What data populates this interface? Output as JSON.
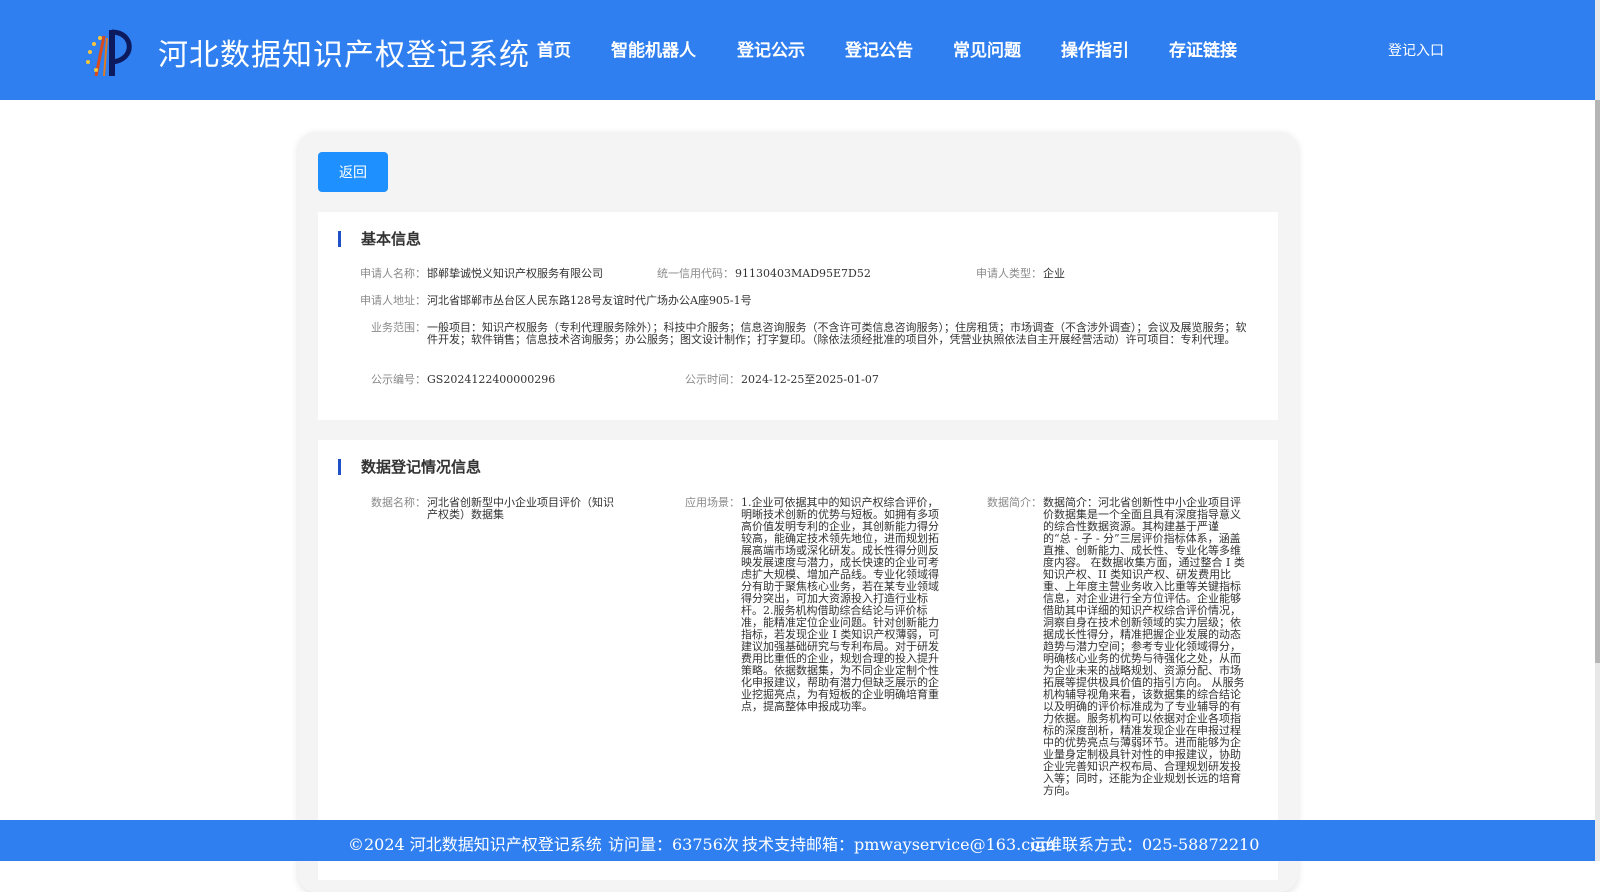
{
  "header": {
    "title": "河北数据知识产权登记系统",
    "nav": [
      "首页",
      "智能机器人",
      "登记公示",
      "登记公告",
      "常见问题",
      "操作指引",
      "存证链接"
    ],
    "login": "登记入口"
  },
  "toolbar": {
    "back_label": "返回"
  },
  "basic_info": {
    "title": "基本信息",
    "applicant_name_label": "申请人名称：",
    "applicant_name": "邯郸挚诚悦义知识产权服务有限公司",
    "credit_code_label": "统一信用代码：",
    "credit_code": "91130403MAD95E7D52",
    "applicant_type_label": "申请人类型：",
    "applicant_type": "企业",
    "address_label": "申请人地址：",
    "address": "河北省邯郸市丛台区人民东路128号友谊时代广场办公A座905-1号",
    "scope_label": "业务范围：",
    "scope": "一般项目：知识产权服务（专利代理服务除外）；科技中介服务；信息咨询服务（不含许可类信息咨询服务）；住房租赁；市场调查（不含涉外调查）；会议及展览服务；软件开发；软件销售；信息技术咨询服务；办公服务；图文设计制作；打字复印。（除依法须经批准的项目外，凭营业执照依法自主开展经营活动）许可项目：专利代理。",
    "pub_no_label": "公示编号：",
    "pub_no": "GS2024122400000296",
    "pub_time_label": "公示时间：",
    "pub_time": "2024-12-25至2025-01-07"
  },
  "data_info": {
    "title": "数据登记情况信息",
    "data_name_label": "数据名称：",
    "data_name": "河北省创新型中小企业项目评价（知识产权类）数据集",
    "scenario_label": "应用场景：",
    "scenario": "1.企业可依据其中的知识产权综合评价，明晰技术创新的优势与短板。如拥有多项高价值发明专利的企业，其创新能力得分较高，能确定技术领先地位，进而规划拓展高端市场或深化研发。成长性得分则反映发展速度与潜力，成长快速的企业可考虑扩大规模、增加产品线。专业化领域得分有助于聚焦核心业务，若在某专业领域得分突出，可加大资源投入打造行业标杆。2.服务机构借助综合结论与评价标准，能精准定位企业问题。针对创新能力指标，若发现企业 I 类知识产权薄弱，可建议加强基础研究与专利布局。对于研发费用比重低的企业，规划合理的投入提升策略。依据数据集，为不同企业定制个性化申报建议，帮助有潜力但缺乏展示的企业挖掘亮点，为有短板的企业明确培育重点，提高整体申报成功率。",
    "summary_label": "数据简介：",
    "summary": "数据简介：河北省创新性中小企业项目评价数据集是一个全面且具有深度指导意义的综合性数据资源。其构建基于严谨的“总 - 子 - 分”三层评价指标体系，涵盖直推、创新能力、成长性、专业化等多维度内容。 在数据收集方面，通过整合 I 类知识产权、II 类知识产权、研发费用比重、上年度主营业务收入比重等关键指标信息，对企业进行全方位评估。企业能够借助其中详细的知识产权综合评价情况，洞察自身在技术创新领域的实力层级；依据成长性得分，精准把握企业发展的动态趋势与潜力空间；参考专业化领域得分，明确核心业务的优势与待强化之处，从而为企业未来的战略规划、资源分配、市场拓展等提供极具价值的指引方向。 从服务机构辅导视角来看，该数据集的综合结论以及明确的评价标准成为了专业辅导的有力依据。服务机构可以依据对企业各项指标的深度剖析，精准发现企业在申报过程中的优势亮点与薄弱环节。进而能够为企业量身定制极具针对性的申报建议，协助企业完善知识产权布局、合理规划研发投入等；同时，还能为企业规划长远的培育方向。"
  },
  "footer": {
    "copyright": "©2024 河北数据知识产权登记系统",
    "visits": "访问量：63756次",
    "email": "技术支持邮箱：pmwayservice@163.com",
    "phone": "运维联系方式：025-58872210"
  },
  "colors": {
    "brand": "#2f7ff0",
    "button": "#1e90ff",
    "title_bar": "#1e50c8"
  },
  "icons": {
    "logo": "logo-icon"
  }
}
